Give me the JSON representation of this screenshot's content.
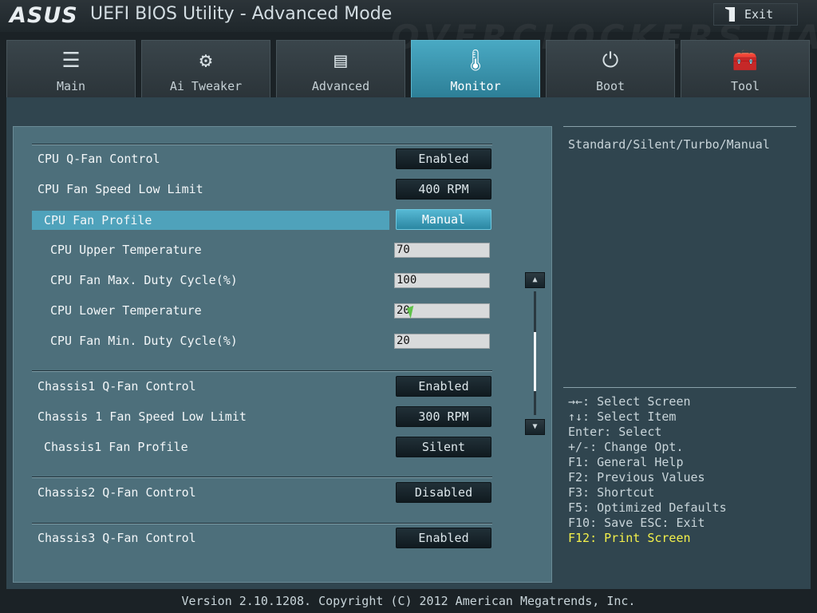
{
  "header": {
    "logo": "ASUS",
    "title": "UEFI BIOS Utility - Advanced Mode",
    "exit_label": "Exit",
    "watermark": "OVERCLOCKERS.UA"
  },
  "tabs": [
    {
      "label": "Main",
      "icon": "list-icon"
    },
    {
      "label": "Ai Tweaker",
      "icon": "tweaker-icon"
    },
    {
      "label": "Advanced",
      "icon": "advanced-icon"
    },
    {
      "label": "Monitor",
      "icon": "thermometer-icon",
      "active": true
    },
    {
      "label": "Boot",
      "icon": "power-icon"
    },
    {
      "label": "Tool",
      "icon": "toolbox-icon"
    }
  ],
  "settings": {
    "cpu_qfan": {
      "label": "CPU Q-Fan Control",
      "value": "Enabled"
    },
    "cpu_low_limit": {
      "label": "CPU Fan Speed Low Limit",
      "value": "400 RPM"
    },
    "cpu_profile": {
      "label": "CPU Fan Profile",
      "value": "Manual"
    },
    "cpu_upper_temp": {
      "label": "CPU Upper Temperature",
      "value": "70"
    },
    "cpu_max_duty": {
      "label": "CPU Fan Max. Duty Cycle(%)",
      "value": "100"
    },
    "cpu_lower_temp": {
      "label": "CPU Lower Temperature",
      "value": "20"
    },
    "cpu_min_duty": {
      "label": "CPU Fan Min. Duty Cycle(%)",
      "value": "20"
    },
    "ch1_qfan": {
      "label": "Chassis1 Q-Fan Control",
      "value": "Enabled"
    },
    "ch1_low_limit": {
      "label": "Chassis 1 Fan Speed Low Limit",
      "value": "300 RPM"
    },
    "ch1_profile": {
      "label": "Chassis1 Fan Profile",
      "value": "Silent"
    },
    "ch2_qfan": {
      "label": "Chassis2 Q-Fan Control",
      "value": "Disabled"
    },
    "ch3_qfan": {
      "label": "Chassis3 Q-Fan Control",
      "value": "Enabled"
    }
  },
  "help": {
    "description": "Standard/Silent/Turbo/Manual"
  },
  "keys": [
    "→←: Select Screen",
    "↑↓: Select Item",
    "Enter: Select",
    "+/-: Change Opt.",
    "F1: General Help",
    "F2: Previous Values",
    "F3: Shortcut",
    "F5: Optimized Defaults",
    "F10: Save  ESC: Exit",
    "F12: Print Screen"
  ],
  "footer": "Version 2.10.1208. Copyright (C) 2012 American Megatrends, Inc.",
  "colors": {
    "accent": "#4fa2bb",
    "highlight_key": "#f3f04a"
  }
}
